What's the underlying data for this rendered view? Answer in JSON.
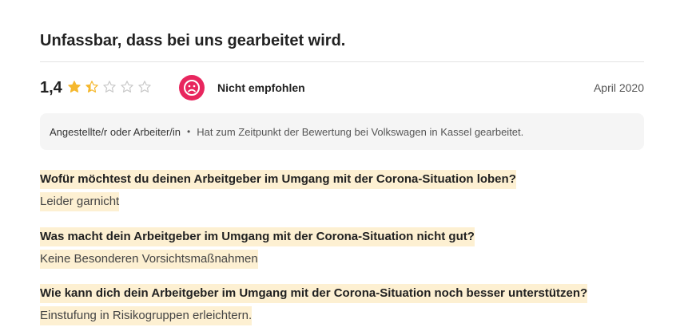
{
  "review": {
    "title": "Unfassbar, dass bei uns gearbeitet wird.",
    "rating": "1,4",
    "stars": 1.4,
    "recommendation": "Nicht empfohlen",
    "date": "April 2020",
    "job_title": "Angestellte/r oder Arbeiter/in",
    "bullet": "•",
    "employment_status": "Hat zum Zeitpunkt der Bewertung bei Volkswagen in Kassel gearbeitet."
  },
  "qa": [
    {
      "question": "Wofür möchtest du deinen Arbeitgeber im Umgang mit der Corona-Situation loben?",
      "answer": "Leider garnicht"
    },
    {
      "question": "Was macht dein Arbeitgeber im Umgang mit der Corona-Situation nicht gut?",
      "answer": "Keine Besonderen Vorsichtsmaßnahmen"
    },
    {
      "question": "Wie kann dich dein Arbeitgeber im Umgang mit der Corona-Situation noch besser unterstützen?",
      "answer": "Einstufung in Risikogruppen erleichtern."
    }
  ],
  "colors": {
    "star": "#f5b82e",
    "star_empty": "#c9c9c9",
    "not_recommended": "#e8265e",
    "highlight": "#fdf0d2"
  },
  "icons": {
    "recommendation": "sad-face-icon",
    "star": "star-icon"
  }
}
